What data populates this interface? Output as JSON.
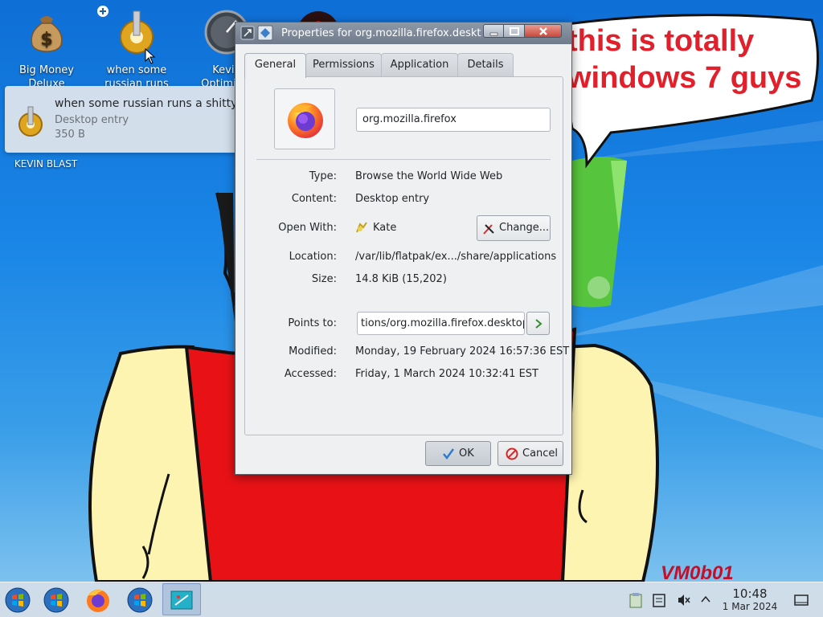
{
  "desktop": {
    "icons": [
      {
        "label": "Big Money Deluxe"
      },
      {
        "label": "when some russian runs a..."
      },
      {
        "label": "Kevin Optimizer"
      }
    ],
    "tooltip": {
      "title": "when some russian runs a shitty rat",
      "type": "Desktop entry",
      "size": "350 B"
    },
    "kevin_blast_label": "KEVIN BLAST",
    "wallpaper_text": {
      "speech_line1": "this is totally",
      "speech_line2": "windows 7 guys",
      "signature": "VM0b01"
    }
  },
  "dialog": {
    "title": "Properties for org.mozilla.firefox.deskt...",
    "tabs": [
      {
        "label": "General",
        "active": true
      },
      {
        "label": "Permissions",
        "active": false
      },
      {
        "label": "Application",
        "active": false
      },
      {
        "label": "Details",
        "active": false
      }
    ],
    "name_value": "org.mozilla.firefox",
    "fields": {
      "type_label": "Type:",
      "type_value": "Browse the World Wide Web",
      "content_label": "Content:",
      "content_value": "Desktop entry",
      "open_with_label": "Open With:",
      "open_with_value": "Kate",
      "change_button": "Change...",
      "location_label": "Location:",
      "location_value": "/var/lib/flatpak/ex.../share/applications",
      "size_label": "Size:",
      "size_value": "14.8 KiB (15,202)",
      "points_to_label": "Points to:",
      "points_to_value": "tions/org.mozilla.firefox.desktop",
      "modified_label": "Modified:",
      "modified_value": "Monday, 19 February 2024 16:57:36 EST",
      "accessed_label": "Accessed:",
      "accessed_value": "Friday, 1 March 2024 10:32:41 EST"
    },
    "buttons": {
      "ok": "OK",
      "cancel": "Cancel"
    }
  },
  "taskbar": {
    "items": [
      "start-orb-icon",
      "windows-orb-icon",
      "firefox-icon",
      "windows-orb-icon",
      "dolphin-icon"
    ],
    "clock": {
      "time": "10:48",
      "date": "1 Mar 2024"
    },
    "tray": [
      "clipboard-icon",
      "notes-icon",
      "volume-muted-icon",
      "chevron-up-icon",
      "show-desktop-icon"
    ]
  },
  "colors": {
    "accent": "#3daee9",
    "speech_text": "#e2202c",
    "titlebar": "#7a8696"
  }
}
